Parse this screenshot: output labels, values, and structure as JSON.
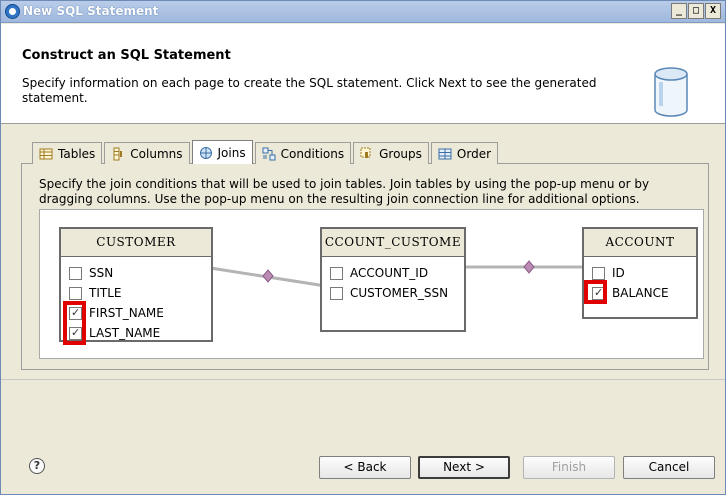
{
  "window": {
    "title": "New SQL Statement",
    "controls": [
      "_",
      "□",
      "X"
    ]
  },
  "header": {
    "title": "Construct an SQL Statement",
    "description": "Specify information on each page to create the SQL statement. Click Next to see the generated statement.",
    "icon": "database-cylinder-icon"
  },
  "tabs": [
    {
      "label": "Tables",
      "icon": "table-icon"
    },
    {
      "label": "Columns",
      "icon": "columns-icon"
    },
    {
      "label": "Joins",
      "icon": "joins-icon",
      "active": true
    },
    {
      "label": "Conditions",
      "icon": "conditions-icon"
    },
    {
      "label": "Groups",
      "icon": "groups-icon"
    },
    {
      "label": "Order",
      "icon": "order-icon"
    }
  ],
  "joins": {
    "instructions": "Specify the join conditions that will be used to join tables. Join tables by using the pop-up menu or by dragging columns. Use the pop-up menu on the resulting join connection line for additional options.",
    "tables": [
      {
        "name": "CUSTOMER",
        "columns": [
          {
            "name": "SSN",
            "checked": false
          },
          {
            "name": "TITLE",
            "checked": false
          },
          {
            "name": "FIRST_NAME",
            "checked": true
          },
          {
            "name": "LAST_NAME",
            "checked": true
          }
        ]
      },
      {
        "name": "CCOUNT_CUSTOME",
        "columns": [
          {
            "name": "ACCOUNT_ID",
            "checked": false
          },
          {
            "name": "CUSTOMER_SSN",
            "checked": false
          }
        ]
      },
      {
        "name": "ACCOUNT",
        "columns": [
          {
            "name": "ID",
            "checked": false
          },
          {
            "name": "BALANCE",
            "checked": true
          }
        ]
      }
    ]
  },
  "buttons": {
    "back": "< Back",
    "next": "Next >",
    "finish": "Finish",
    "cancel": "Cancel",
    "help": "?"
  },
  "colors": {
    "highlight": "#e00000",
    "title_bar": "#9fb8dd"
  }
}
